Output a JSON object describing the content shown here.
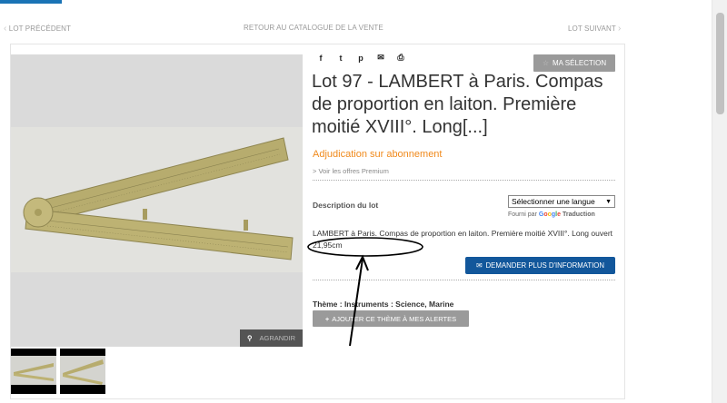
{
  "nav": {
    "prev": "LOT PRÉCÉDENT",
    "catalogue": "RETOUR AU CATALOGUE DE LA VENTE",
    "next": "LOT SUIVANT"
  },
  "image": {
    "enlarge_label": "AGRANDIR"
  },
  "share_icons": [
    "facebook-icon",
    "twitter-icon",
    "pinterest-icon",
    "mail-icon",
    "print-icon"
  ],
  "share_glyphs": [
    "f",
    "t",
    "p",
    "✉",
    "⎙"
  ],
  "ma_selection": "MA SÉLECTION",
  "lot": {
    "title": "Lot 97 - LAMBERT à Paris. Compas de proportion en laiton. Première moitié XVIII°. Long[...]",
    "adjudication": "Adjudication sur abonnement",
    "premium_link": "> Voir les offres Premium"
  },
  "description": {
    "label": "Description du lot",
    "language_select": "Sélectionner une langue",
    "powered_by": "Fourni par",
    "google": "Google",
    "traduction": "Traduction",
    "text": "LAMBERT à Paris. Compas de proportion en laiton. Première moitié XVIII°. Long ouvert 21,95cm"
  },
  "demander_button": "DEMANDER PLUS D'INFORMATION",
  "theme": {
    "label": "Thème : Instruments : Science, Marine",
    "add_alert": "AJOUTER CE THÈME À MES ALERTES"
  },
  "colors": {
    "accent": "#1a73b5",
    "orange": "#f08a1c",
    "button_blue": "#12579b",
    "gray_button": "#9a9a9a"
  }
}
